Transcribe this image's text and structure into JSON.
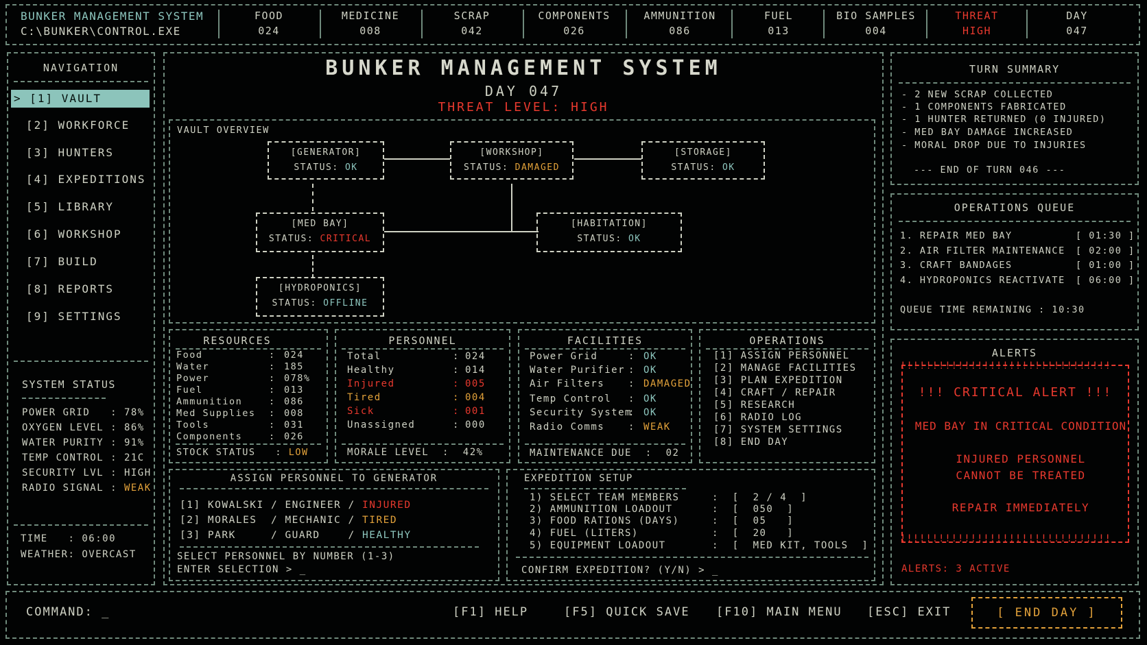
{
  "topbar": {
    "title": "BUNKER MANAGEMENT SYSTEM",
    "path": "C:\\BUNKER\\CONTROL.EXE",
    "stats": [
      {
        "label": "FOOD",
        "value": "024"
      },
      {
        "label": "MEDICINE",
        "value": "008"
      },
      {
        "label": "SCRAP",
        "value": "042"
      },
      {
        "label": "COMPONENTS",
        "value": "026"
      },
      {
        "label": "AMMUNITION",
        "value": "086"
      },
      {
        "label": "FUEL",
        "value": "013"
      },
      {
        "label": "BIO SAMPLES",
        "value": "004"
      },
      {
        "label": "THREAT",
        "value": "HIGH"
      },
      {
        "label": "DAY",
        "value": "047"
      }
    ]
  },
  "nav": {
    "title": "NAVIGATION",
    "items": [
      {
        "label": "> [1] VAULT"
      },
      {
        "label": "[2] WORKFORCE"
      },
      {
        "label": "[3] HUNTERS"
      },
      {
        "label": "[4] EXPEDITIONS"
      },
      {
        "label": "[5] LIBRARY"
      },
      {
        "label": "[6] WORKSHOP"
      },
      {
        "label": "[7] BUILD"
      },
      {
        "label": "[8] REPORTS"
      },
      {
        "label": "[9] SETTINGS"
      }
    ]
  },
  "system_status": {
    "title": "SYSTEM STATUS",
    "rows": [
      {
        "label": "POWER GRID   :",
        "value": "78%"
      },
      {
        "label": "OXYGEN LEVEL :",
        "value": "86%"
      },
      {
        "label": "WATER PURITY :",
        "value": "91%"
      },
      {
        "label": "TEMP CONTROL :",
        "value": "21C"
      },
      {
        "label": "SECURITY LVL :",
        "value": "HIGH"
      },
      {
        "label": "RADIO SIGNAL :",
        "value": "WEAK"
      }
    ],
    "time": "TIME   : 06:00",
    "weather": "WEATHER: OVERCAST"
  },
  "main": {
    "title": "BUNKER MANAGEMENT SYSTEM",
    "day": "DAY 047",
    "threat": "THREAT LEVEL: HIGH",
    "vault_title": "VAULT OVERVIEW",
    "status_label": "STATUS:",
    "nodes": {
      "generator": {
        "name": "[GENERATOR]",
        "status": "OK"
      },
      "workshop": {
        "name": "[WORKSHOP]",
        "status": "DAMAGED"
      },
      "storage": {
        "name": "[STORAGE]",
        "status": "OK"
      },
      "medbay": {
        "name": "[MED BAY]",
        "status": "CRITICAL"
      },
      "habitation": {
        "name": "[HABITATION]",
        "status": "OK"
      },
      "hydroponics": {
        "name": "[HYDROPONICS]",
        "status": "OFFLINE"
      }
    }
  },
  "resources": {
    "title": "RESOURCES",
    "rows": [
      {
        "label": "Food",
        "value": "024"
      },
      {
        "label": "Water",
        "value": "185"
      },
      {
        "label": "Power",
        "value": "078%"
      },
      {
        "label": "Fuel",
        "value": "013"
      },
      {
        "label": "Ammunition",
        "value": "086"
      },
      {
        "label": "Med Supplies",
        "value": "008"
      },
      {
        "label": "Tools",
        "value": "031"
      },
      {
        "label": "Components",
        "value": "026"
      }
    ],
    "footer_label": "STOCK STATUS   :",
    "footer_value": "LOW"
  },
  "personnel": {
    "title": "PERSONNEL",
    "rows": [
      {
        "label": "Total",
        "value": "024"
      },
      {
        "label": "Healthy",
        "value": "014"
      },
      {
        "label": "Injured",
        "value": "005"
      },
      {
        "label": "Tired",
        "value": "004"
      },
      {
        "label": "Sick",
        "value": "001"
      },
      {
        "label": "Unassigned",
        "value": "000"
      }
    ],
    "footer": "MORALE LEVEL  :  42%"
  },
  "facilities": {
    "title": "FACILITIES",
    "rows": [
      {
        "label": "Power Grid",
        "value": "OK"
      },
      {
        "label": "Water Purifier",
        "value": "OK"
      },
      {
        "label": "Air Filters",
        "value": "DAMAGED"
      },
      {
        "label": "Temp Control",
        "value": "OK"
      },
      {
        "label": "Security System",
        "value": "OK"
      },
      {
        "label": "Radio Comms",
        "value": "WEAK"
      }
    ],
    "footer": "MAINTENANCE DUE  :  02"
  },
  "operations": {
    "title": "OPERATIONS",
    "items": [
      "[1] ASSIGN PERSONNEL",
      "[2] MANAGE FACILITIES",
      "[3] PLAN EXPEDITION",
      "[4] CRAFT / REPAIR",
      "[5] RESEARCH",
      "[6] RADIO LOG",
      "[7] SYSTEM SETTINGS",
      "[8] END DAY"
    ]
  },
  "assign": {
    "title": "ASSIGN PERSONNEL TO GENERATOR",
    "rows": [
      {
        "text": "[1] KOWALSKI / ENGINEER / ",
        "status": "INJURED"
      },
      {
        "text": "[2] MORALES  / MECHANIC / ",
        "status": "TIRED"
      },
      {
        "text": "[3] PARK     / GUARD    / ",
        "status": "HEALTHY"
      }
    ],
    "prompt1": "SELECT PERSONNEL BY NUMBER (1-3)",
    "prompt2": "ENTER SELECTION > _"
  },
  "expedition": {
    "title": "EXPEDITION SETUP",
    "rows": [
      {
        "label": "1) SELECT TEAM MEMBERS",
        "value": ":  [  2 / 4  ]"
      },
      {
        "label": "2) AMMUNITION LOADOUT",
        "value": ":  [  050  ]"
      },
      {
        "label": "3) FOOD RATIONS (DAYS)",
        "value": ":  [  05   ]"
      },
      {
        "label": "4) FUEL (LITERS)",
        "value": ":  [  20   ]"
      },
      {
        "label": "5) EQUIPMENT LOADOUT",
        "value": ":  [  MED KIT, TOOLS  ]"
      }
    ],
    "confirm": "CONFIRM EXPEDITION? (Y/N) > _"
  },
  "turn_summary": {
    "title": "TURN SUMMARY",
    "items": [
      "- 2 NEW SCRAP COLLECTED",
      "- 1 COMPONENTS FABRICATED",
      "- 1 HUNTER RETURNED (0 INJURED)",
      "- MED BAY DAMAGE INCREASED",
      "- MORAL DROP DUE TO INJURIES"
    ],
    "end": "--- END OF TURN 046 ---"
  },
  "queue": {
    "title": "OPERATIONS QUEUE",
    "items": [
      {
        "label": "1. REPAIR MED BAY",
        "time": "[ 01:30 ]"
      },
      {
        "label": "2. AIR FILTER MAINTENANCE",
        "time": "[ 02:00 ]"
      },
      {
        "label": "3. CRAFT BANDAGES",
        "time": "[ 01:00 ]"
      },
      {
        "label": "4. HYDROPONICS REACTIVATE",
        "time": "[ 06:00 ]"
      }
    ],
    "remaining": "QUEUE TIME REMAINING : 10:30"
  },
  "alerts": {
    "title": "ALERTS",
    "bang_row": "!!!!!!!!!!!!!!!!!!!!!!!!!!!!!!!!!",
    "critical": "!!! CRITICAL ALERT !!!",
    "line1": "MED BAY IN CRITICAL CONDITION",
    "line2a": "INJURED PERSONNEL",
    "line2b": "CANNOT BE TREATED",
    "line3": "REPAIR IMMEDIATELY",
    "count": "ALERTS: 3 ACTIVE"
  },
  "commandbar": {
    "label": "COMMAND: _",
    "keys": [
      {
        "key": "[F1]",
        "label": "HELP"
      },
      {
        "key": "[F5]",
        "label": "QUICK SAVE"
      },
      {
        "key": "[F10]",
        "label": "MAIN MENU"
      },
      {
        "key": "[ESC]",
        "label": "EXIT"
      }
    ],
    "end_day": "[ END DAY ]"
  },
  "colors": {
    "border": "#6f8a7c",
    "text": "#cfd2c4",
    "accent_cyan": "#8ec7bf",
    "alert_red": "#e8392e",
    "warn_orange": "#e3a23a"
  }
}
